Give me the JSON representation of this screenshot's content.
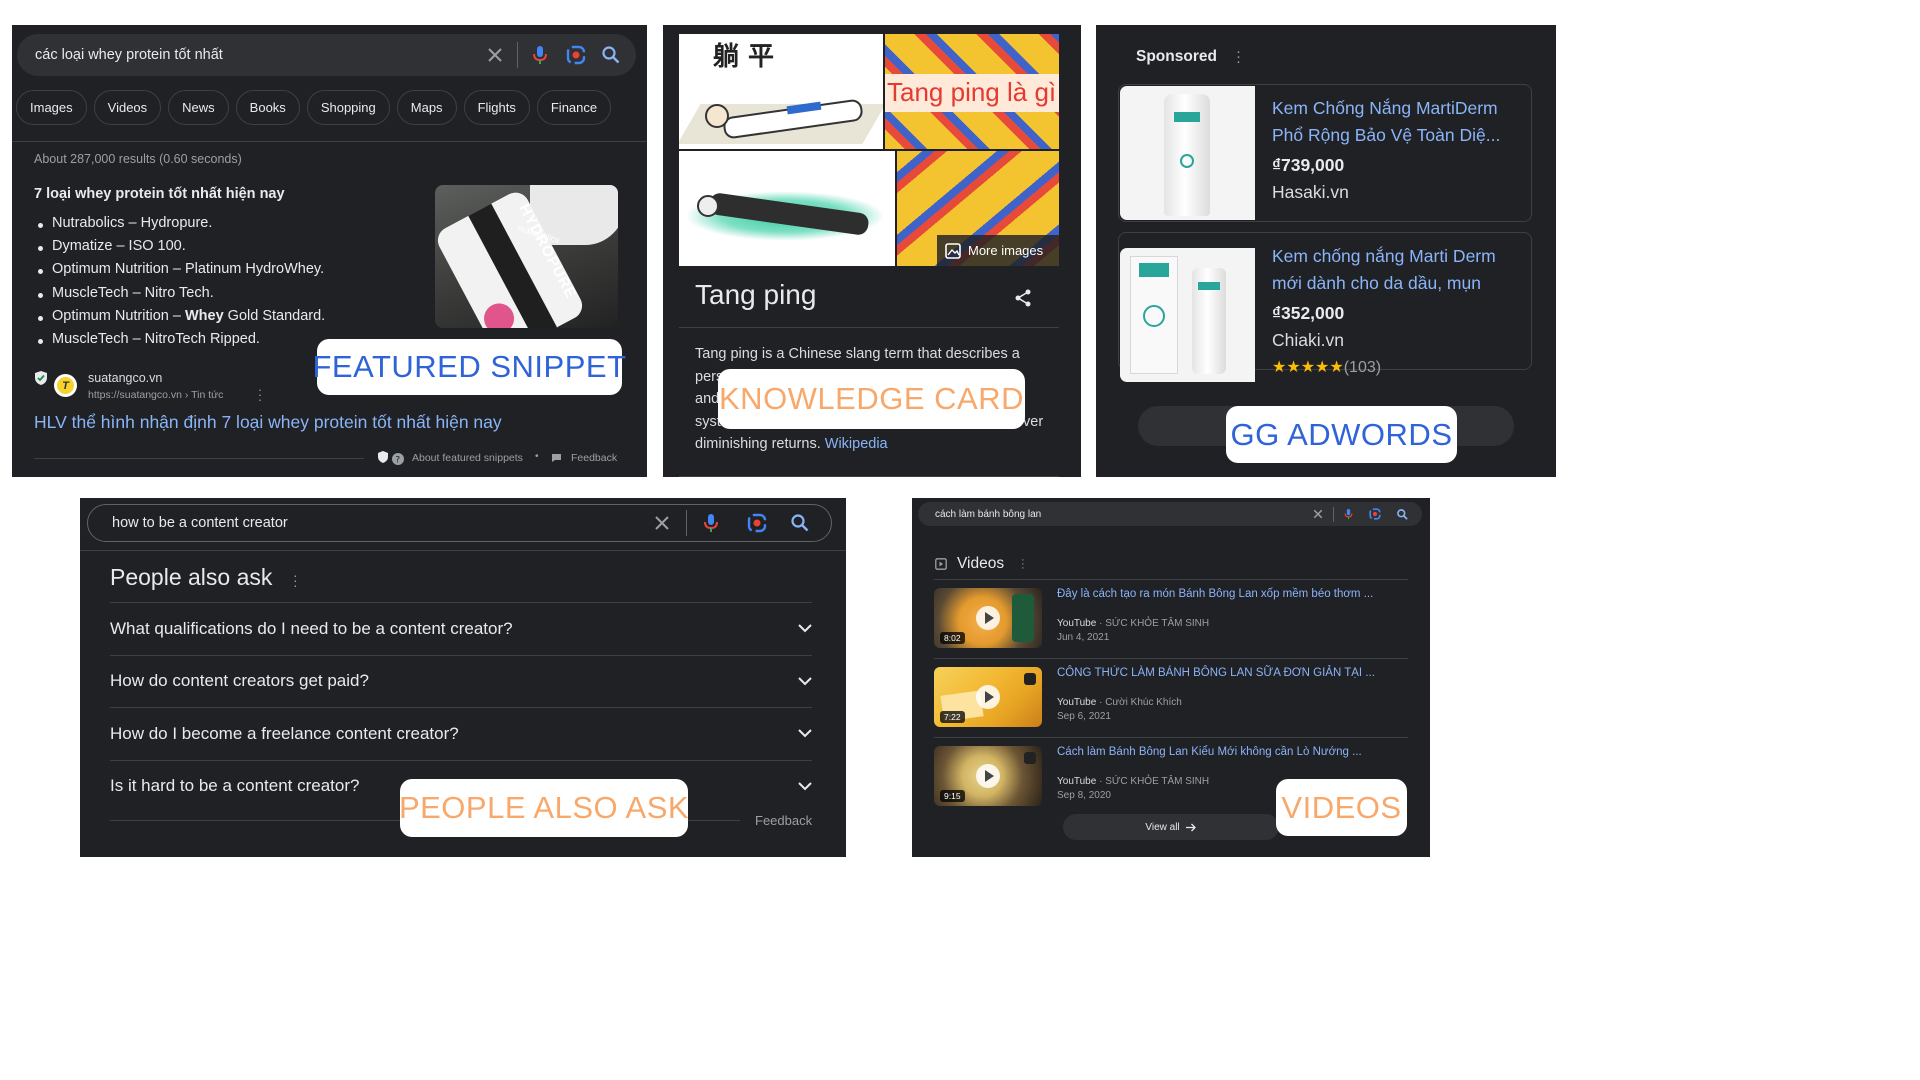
{
  "featured": {
    "query": "các loại whey protein tốt nhất",
    "chips": [
      "Images",
      "Videos",
      "News",
      "Books",
      "Shopping",
      "Maps",
      "Flights",
      "Finance"
    ],
    "result_stats": "About 287,000 results (0.60 seconds)",
    "snippet_title": "7 loại whey protein tốt nhất hiện nay",
    "list": [
      "Nutrabolics – Hydropure.",
      "Dymatize – ISO 100.",
      "Optimum Nutrition – Platinum HydroWhey.",
      "MuscleTech – Nitro Tech.",
      "Optimum Nutrition – Whey Gold Standard.",
      "MuscleTech – NitroTech Ripped."
    ],
    "image_text_1": "HYDROPURE",
    "image_text_2": "nutrabolics",
    "source_name": "suatangco.vn",
    "source_logo_letter": "T",
    "source_url": "https://suatangco.vn › Tin tức",
    "result_link": "HLV thể hình nhận định 7 loại whey protein tốt nhất hiện nay",
    "about_label": "About featured snippets",
    "dot": "•",
    "feedback": "Feedback",
    "callout": "FEATURED SNIPPET"
  },
  "knowledge": {
    "chinese_chars": "躺 平",
    "image_overlay_text": "Tang ping là gì",
    "more_images": "More images",
    "title": "Tang ping",
    "desc_1": "Tang ping is a Chinese slang term that describes a",
    "desc_2": "pers",
    "desc_3": "and",
    "desc_4": "syst",
    "desc_4_end": "ver",
    "desc_5": "diminishing returns.",
    "wiki_link": "Wikipedia",
    "callout": "KNOWLEDGE CARD"
  },
  "ads": {
    "sponsored": "Sponsored",
    "items": [
      {
        "title_1": "Kem Chống Nắng MartiDerm",
        "title_2": "Phổ Rộng Bảo Vệ Toàn Diệ...",
        "price": "₫739,000",
        "store": "Hasaki.vn"
      },
      {
        "title_1": "Kem chống nắng Marti Derm",
        "title_2": "mới dành cho da dầu, mụn",
        "price": "₫352,000",
        "store": "Chiaki.vn",
        "stars": "★★★★★",
        "reviews": "(103)"
      }
    ],
    "callout": "GG ADWORDS"
  },
  "paa": {
    "query": "how to be a content creator",
    "heading": "People also ask",
    "questions": [
      "What qualifications do I need to be a content creator?",
      "How do content creators get paid?",
      "How do I become a freelance content creator?",
      "Is it hard to be a content creator?"
    ],
    "feedback": "Feedback",
    "callout": "PEOPLE ALSO ASK"
  },
  "videos": {
    "query": "cách làm bánh bông lan",
    "heading": "Videos",
    "items": [
      {
        "title": "Đây là cách tạo ra món Bánh Bông Lan xốp mềm béo thơm ...",
        "source": "YouTube",
        "channel": "SỨC KHỎE TÂM SINH",
        "date": "Jun 4, 2021",
        "duration": "8:02"
      },
      {
        "title": "CÔNG THỨC LÀM BÁNH BÔNG LAN SỮA ĐƠN GIẢN TẠI ...",
        "source": "YouTube",
        "channel": "Cười Khúc Khích",
        "date": "Sep 6, 2021",
        "duration": "7:22"
      },
      {
        "title": "Cách làm Bánh Bông Lan Kiểu Mới không cần Lò Nướng ...",
        "source": "YouTube",
        "channel": "SỨC KHỎE TÂM SINH",
        "date": "Sep 8, 2020",
        "duration": "9:15"
      }
    ],
    "sep": "·",
    "view_all": "View all",
    "callout": "VIDEOS"
  },
  "colors": {
    "panel_bg": "#202124",
    "link_blue": "#8ab4f8",
    "callout_blue": "#2f63d8",
    "callout_orange": "#f7a86a",
    "star_yellow": "#fbbc04"
  }
}
